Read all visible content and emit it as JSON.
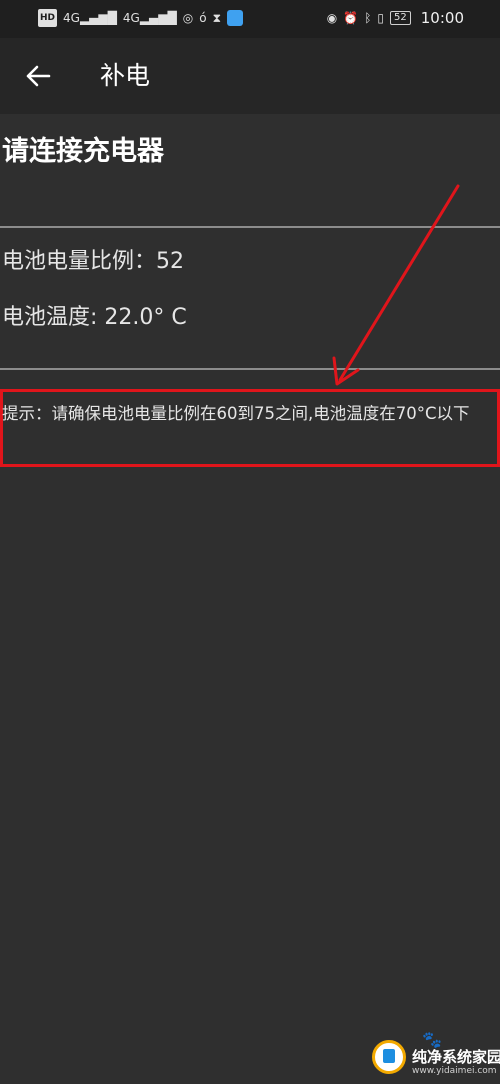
{
  "status_bar": {
    "hd_label": "HD",
    "signal_1_label": "4G",
    "signal_2_label": "4G",
    "time": "10:00",
    "battery_level": "52"
  },
  "app_bar": {
    "title": "补电"
  },
  "main": {
    "heading": "请连接充电器",
    "battery_ratio_label": "电池电量比例：",
    "battery_ratio_value": "52",
    "battery_temp_label": "电池温度:",
    "battery_temp_value": "22.0° C",
    "tip_text": "提示：请确保电池电量比例在60到75之间,电池温度在70°C以下"
  },
  "annotation": {
    "highlight_color": "#e0151b"
  },
  "watermark": {
    "title": "纯净系统家园",
    "url": "www.yidaimei.com"
  }
}
